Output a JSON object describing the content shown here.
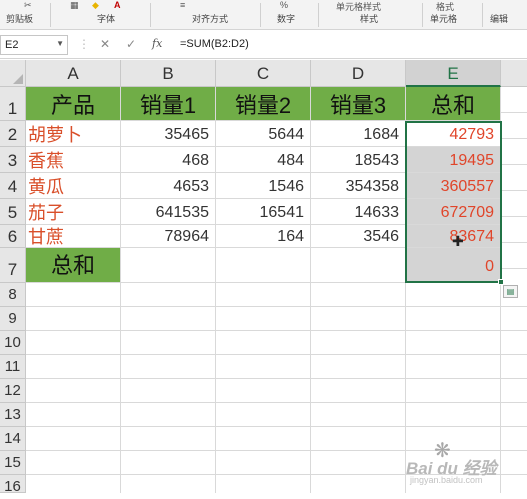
{
  "ribbon": {
    "groups": [
      "剪贴板",
      "字体",
      "对齐方式",
      "数字",
      "样式",
      "单元格",
      "编辑"
    ],
    "styles_button": "单元格样式",
    "format_button": "格式"
  },
  "formula_bar": {
    "name_box": "E2",
    "formula": "=SUM(B2:D2)",
    "cancel_glyph": "✕",
    "enter_glyph": "✓",
    "fx_label": "fx"
  },
  "sheet": {
    "columns": [
      "A",
      "B",
      "C",
      "D",
      "E"
    ],
    "rows": [
      "1",
      "2",
      "3",
      "4",
      "5",
      "6",
      "7",
      "8",
      "9",
      "10",
      "11",
      "12",
      "13",
      "14",
      "15",
      "16"
    ],
    "header": [
      "产品",
      "销量1",
      "销量2",
      "销量3",
      "总和"
    ],
    "data": [
      {
        "product": "胡萝卜",
        "s1": "35465",
        "s2": "5644",
        "s3": "1684",
        "total": "42793"
      },
      {
        "product": "香蕉",
        "s1": "468",
        "s2": "484",
        "s3": "18543",
        "total": "19495"
      },
      {
        "product": "黄瓜",
        "s1": "4653",
        "s2": "1546",
        "s3": "354358",
        "total": "360557"
      },
      {
        "product": "茄子",
        "s1": "641535",
        "s2": "16541",
        "s3": "14633",
        "total": "672709"
      },
      {
        "product": "甘蔗",
        "s1": "78964",
        "s2": "164",
        "s3": "3546",
        "total": "83674"
      }
    ],
    "total_row": {
      "label": "总和",
      "value": "0"
    }
  },
  "watermark": {
    "brand": "Bai du 经验",
    "url": "jingyan.baidu.com"
  },
  "colors": {
    "header_green": "#70ad47",
    "selection_green": "#217346",
    "name_red": "#d94f2a",
    "sum_gray": "#d4d4d4"
  }
}
